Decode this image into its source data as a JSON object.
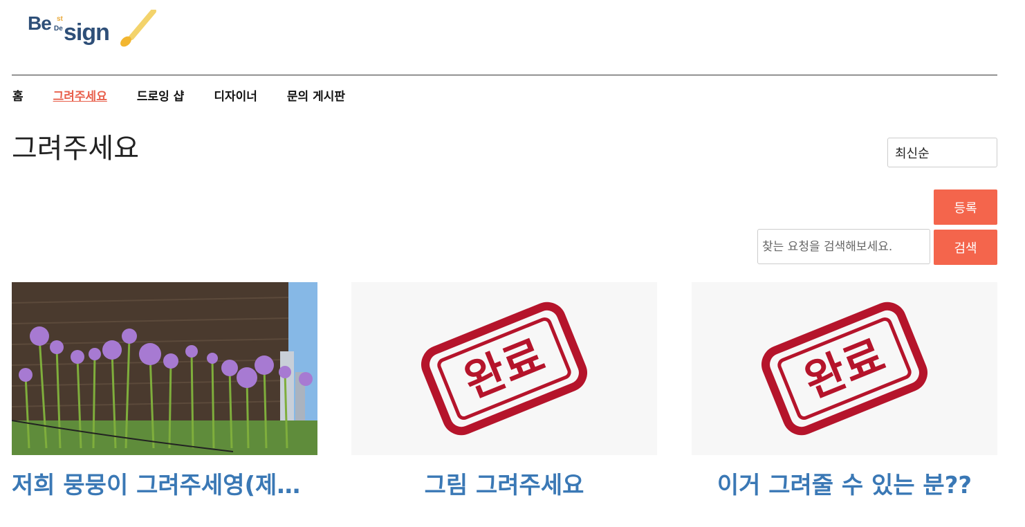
{
  "logo": {
    "be": "Be",
    "st": "st",
    "de": "De",
    "sign": "sign"
  },
  "nav": {
    "items": [
      {
        "label": "홈"
      },
      {
        "label": "그려주세요"
      },
      {
        "label": "드로잉 샵"
      },
      {
        "label": "디자이너"
      },
      {
        "label": "문의 게시판"
      }
    ],
    "active_index": 1
  },
  "page": {
    "title": "그려주세요"
  },
  "sort": {
    "selected": "최신순"
  },
  "actions": {
    "register_label": "등록",
    "search_label": "검색",
    "search_placeholder": "찾는 요청을 검색해보세요."
  },
  "cards": [
    {
      "title": "저희 뭉뭉이 그려주세영(제…",
      "image": "flower-photo"
    },
    {
      "title": "그림 그려주세요",
      "image": "completed-stamp",
      "stamp_text": "완료"
    },
    {
      "title": "이거 그려줄 수 있는 분??",
      "image": "completed-stamp",
      "stamp_text": "완료"
    }
  ],
  "colors": {
    "accent": "#f4654c",
    "link": "#3a78b5",
    "stamp": "#b5142b",
    "logo": "#2e4f78"
  }
}
